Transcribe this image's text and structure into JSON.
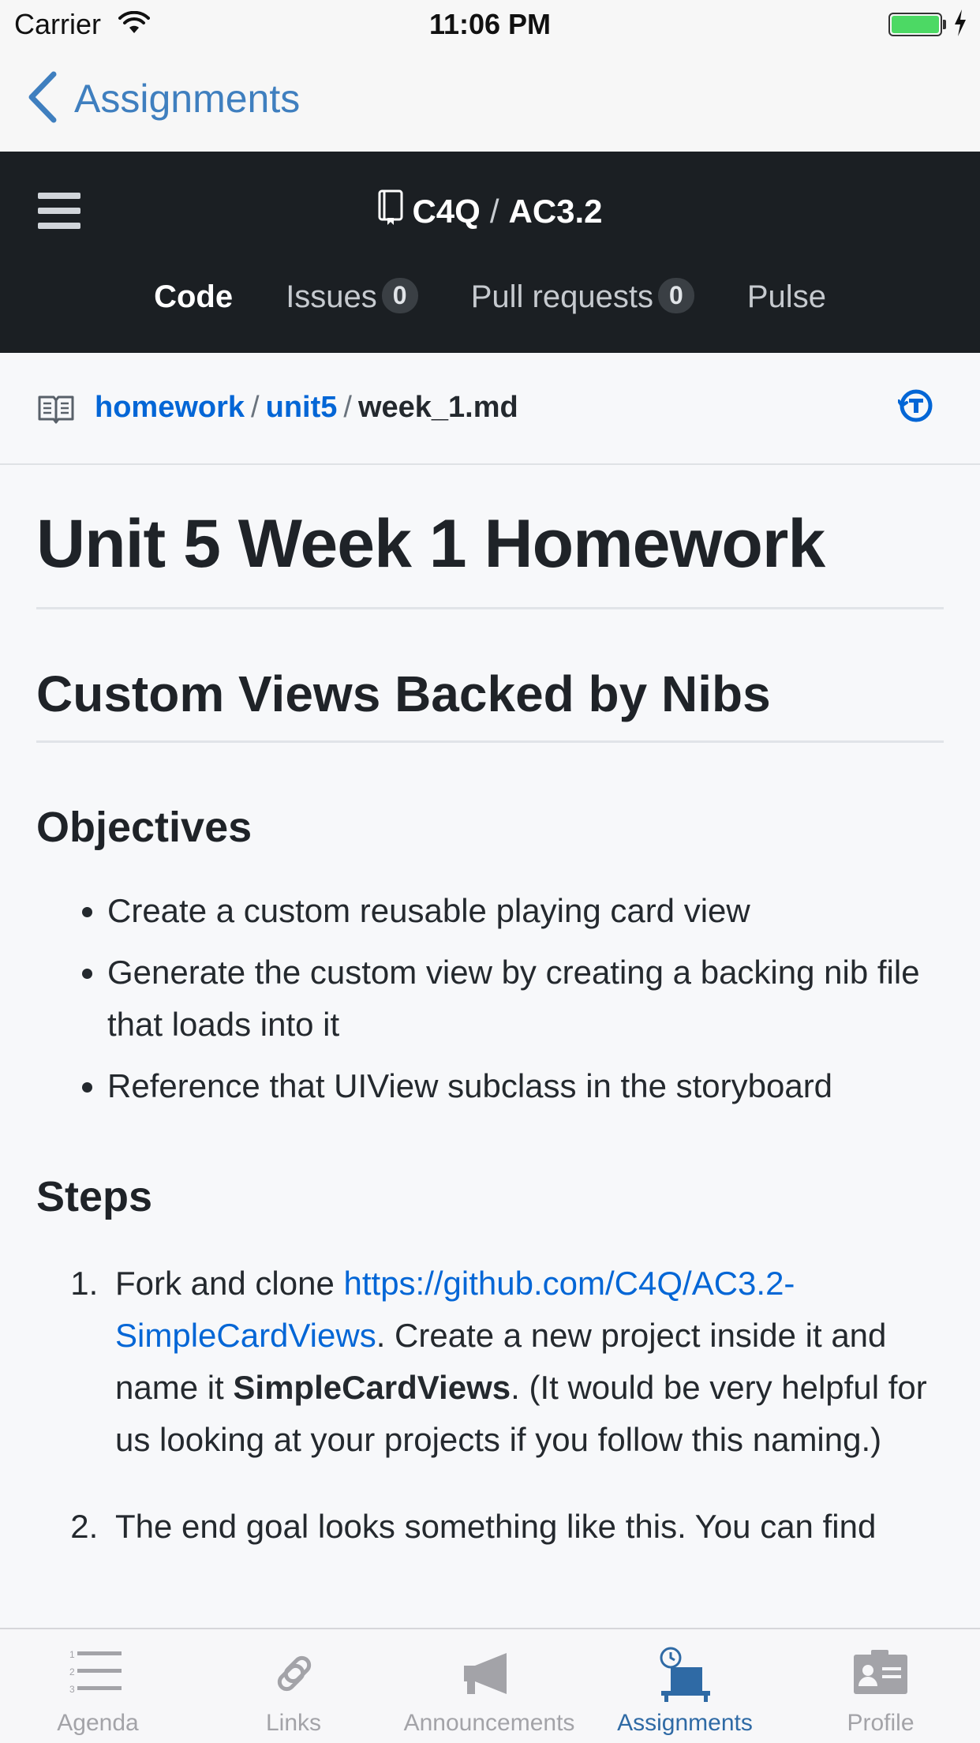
{
  "status_bar": {
    "carrier": "Carrier",
    "time": "11:06 PM"
  },
  "nav": {
    "back_label": "Assignments"
  },
  "repo": {
    "owner": "C4Q",
    "separator": "/",
    "name": "AC3.2",
    "tabs": [
      {
        "label": "Code",
        "count": null
      },
      {
        "label": "Issues",
        "count": "0"
      },
      {
        "label": "Pull requests",
        "count": "0"
      },
      {
        "label": "Pulse",
        "count": null
      }
    ]
  },
  "breadcrumb": {
    "parts": [
      "homework",
      "unit5",
      "week_1.md"
    ],
    "separator": "/"
  },
  "document": {
    "h1": "Unit 5 Week 1 Homework",
    "h2": "Custom Views Backed by Nibs",
    "objectives_heading": "Objectives",
    "objectives": [
      "Create a custom reusable playing card view",
      "Generate the custom view by creating a backing nib file that loads into it",
      "Reference that UIView subclass in the storyboard"
    ],
    "steps_heading": "Steps",
    "steps": [
      {
        "text_before_link": "Fork and clone ",
        "link": "https://github.com/C4Q/AC3.2-SimpleCardViews",
        "text_after_link": ". Create a new project inside it and name it ",
        "strong": "SimpleCardViews",
        "text_end": ". (It would be very helpful for us looking at your projects if you follow this naming.)"
      },
      {
        "text": "The end goal looks something like this. You can find"
      }
    ]
  },
  "tab_bar": {
    "items": [
      {
        "label": "Agenda",
        "icon": "list-icon",
        "selected": false
      },
      {
        "label": "Links",
        "icon": "link-icon",
        "selected": false
      },
      {
        "label": "Announcements",
        "icon": "megaphone-icon",
        "selected": false
      },
      {
        "label": "Assignments",
        "icon": "desk-clock-icon",
        "selected": true
      },
      {
        "label": "Profile",
        "icon": "id-card-icon",
        "selected": false
      }
    ]
  },
  "colors": {
    "link": "#0366d6",
    "header_bg": "#1b1f23",
    "ios_tint": "#3f7fbf",
    "tab_selected": "#2f6aa5"
  }
}
